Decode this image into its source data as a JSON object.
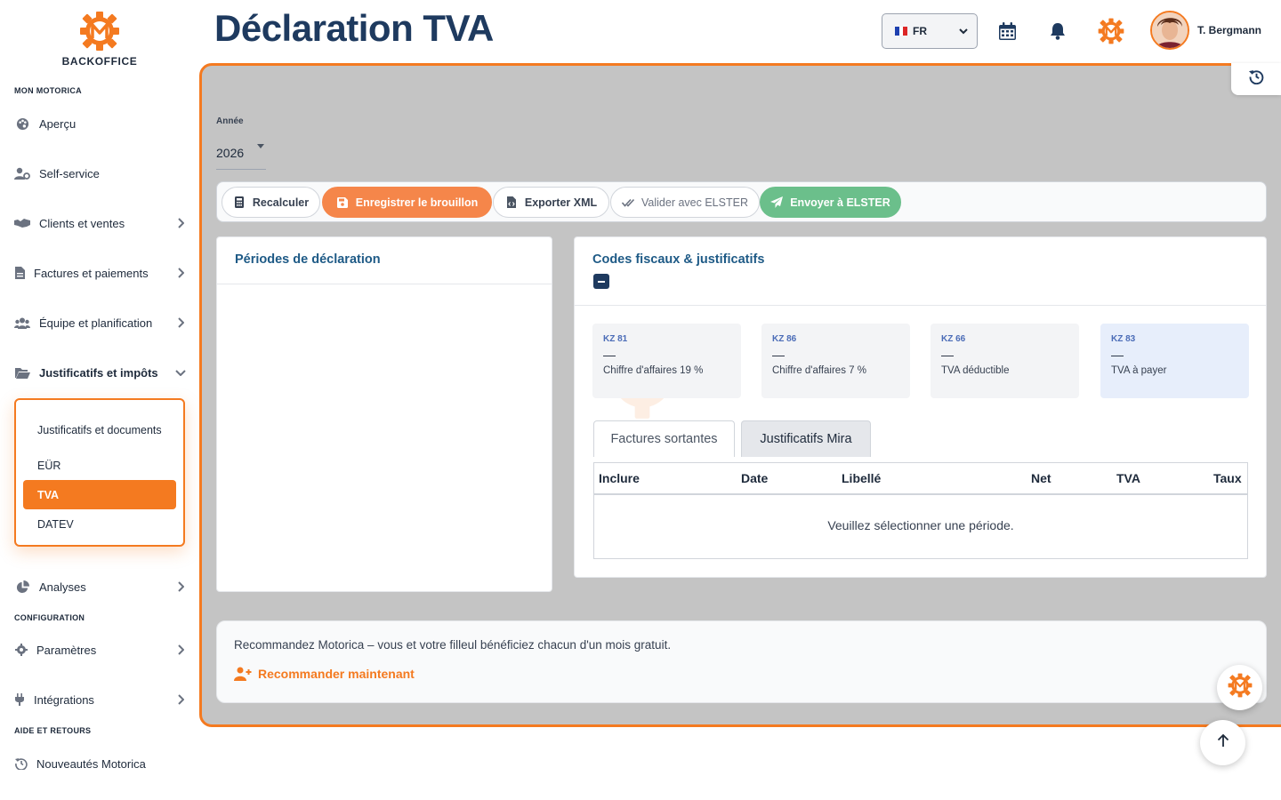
{
  "brand": {
    "label": "BACKOFFICE"
  },
  "sidebar": {
    "sections": {
      "mon_motorica": "MON MOTORICA",
      "configuration": "CONFIGURATION",
      "aide": "AIDE ET RETOURS"
    },
    "items": {
      "apercu": "Aperçu",
      "self_service": "Self-service",
      "clients": "Clients et ventes",
      "factures": "Factures et paiements",
      "equipe": "Équipe et planification",
      "justificatifs": "Justificatifs et impôts",
      "analyses": "Analyses",
      "parametres": "Paramètres",
      "integrations": "Intégrations",
      "nouveautes": "Nouveautés Motorica"
    },
    "submenu": {
      "justif_docs": "Justificatifs et documents",
      "eur": "EÜR",
      "tva": "TVA",
      "datev": "DATEV"
    }
  },
  "header": {
    "title": "Déclaration TVA",
    "language": "FR",
    "user_name": "T. Bergmann"
  },
  "form": {
    "year_label": "Année",
    "year_value": "2026"
  },
  "toolbar": {
    "recalculer": "Recalculer",
    "enregistrer": "Enregistrer le brouillon",
    "exporter": "Exporter XML",
    "valider": "Valider avec ELSTER",
    "envoyer": "Envoyer à ELSTER"
  },
  "periodes": {
    "title": "Périodes de déclaration"
  },
  "codes": {
    "title": "Codes fiscaux & justificatifs",
    "kz": [
      {
        "code": "KZ 81",
        "value": "—",
        "label": "Chiffre d'affaires 19 %"
      },
      {
        "code": "KZ 86",
        "value": "—",
        "label": "Chiffre d'affaires 7 %"
      },
      {
        "code": "KZ 66",
        "value": "—",
        "label": "TVA déductible"
      },
      {
        "code": "KZ 83",
        "value": "—",
        "label": "TVA à payer"
      }
    ],
    "tabs": {
      "sortantes": "Factures sortantes",
      "mira": "Justificatifs Mira"
    },
    "table": {
      "headers": {
        "inclure": "Inclure",
        "date": "Date",
        "libelle": "Libellé",
        "net": "Net",
        "tva": "TVA",
        "taux": "Taux"
      },
      "empty": "Veuillez sélectionner une période."
    }
  },
  "referral": {
    "text": "Recommandez Motorica – vous et votre filleul bénéficiez chacun d'un mois gratuit.",
    "link": "Recommander maintenant"
  },
  "colors": {
    "accent": "#f47a20",
    "navy": "#1e3a5f",
    "success": "#6bbf8b"
  }
}
